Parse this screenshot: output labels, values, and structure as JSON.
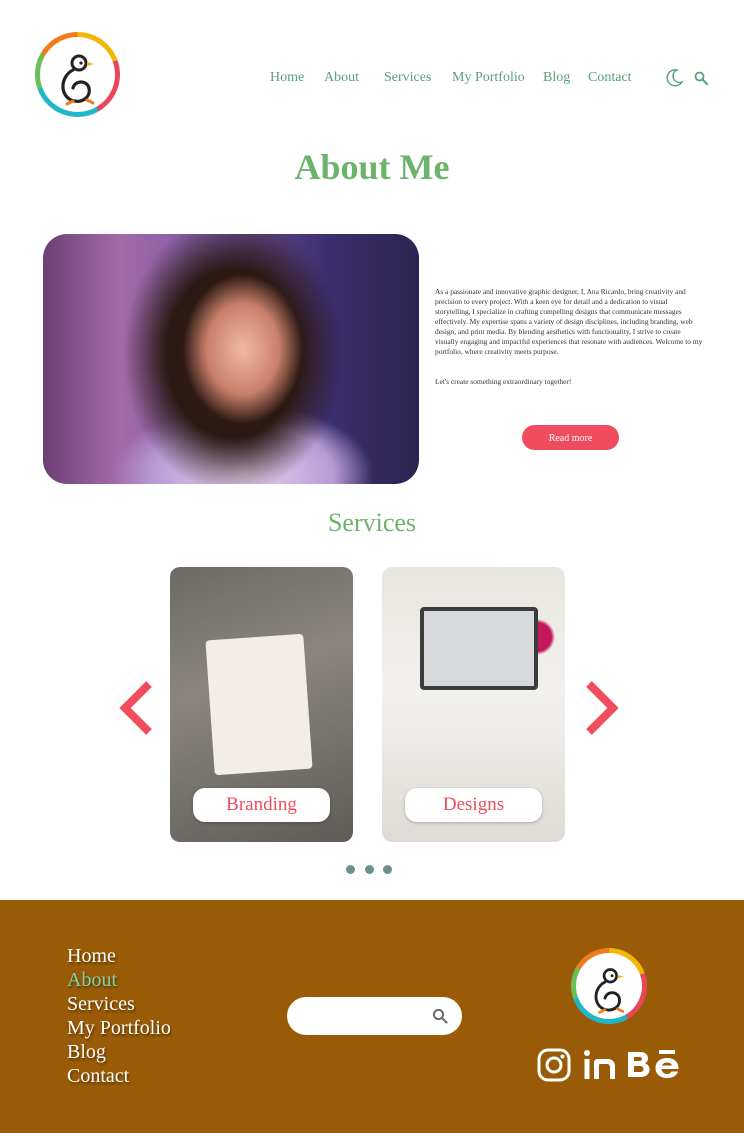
{
  "header": {
    "nav": [
      "Home",
      "About",
      "Services",
      "My Portfolio",
      "Blog",
      "Contact"
    ],
    "icons": [
      "moon-icon",
      "search-icon"
    ]
  },
  "about": {
    "title": "About Me",
    "bio": "As a passionate and innovative graphic designer, I, Ana Ricardo, bring creativity and precision to every project. With a keen eye for detail and a dedication to visual storytelling, I specialize in crafting compelling designs that communicate messages effectively. My expertise spans a variety of design disciplines, including branding, web design, and print media. By blending aesthetics with functionality, I strive to create visually engaging and impactful experiences that resonate with audiences. Welcome to my portfolio, where creativity meets purpose.",
    "cta": "Let's create something extraordinary together!",
    "read_more": "Read more"
  },
  "services": {
    "title": "Services",
    "cards": [
      "Branding",
      "Designs"
    ]
  },
  "footer": {
    "links": [
      "Home",
      "About",
      "Services",
      "My Portfolio",
      "Blog",
      "Contact"
    ],
    "active_link": "About",
    "search_placeholder": "",
    "social": [
      "instagram-icon",
      "linkedin-icon",
      "behance-icon"
    ]
  },
  "colors": {
    "accent_green": "#6cb46c",
    "accent_red": "#ef4c5d",
    "footer_brown": "#995b06",
    "active_link": "#7ed3a8"
  }
}
